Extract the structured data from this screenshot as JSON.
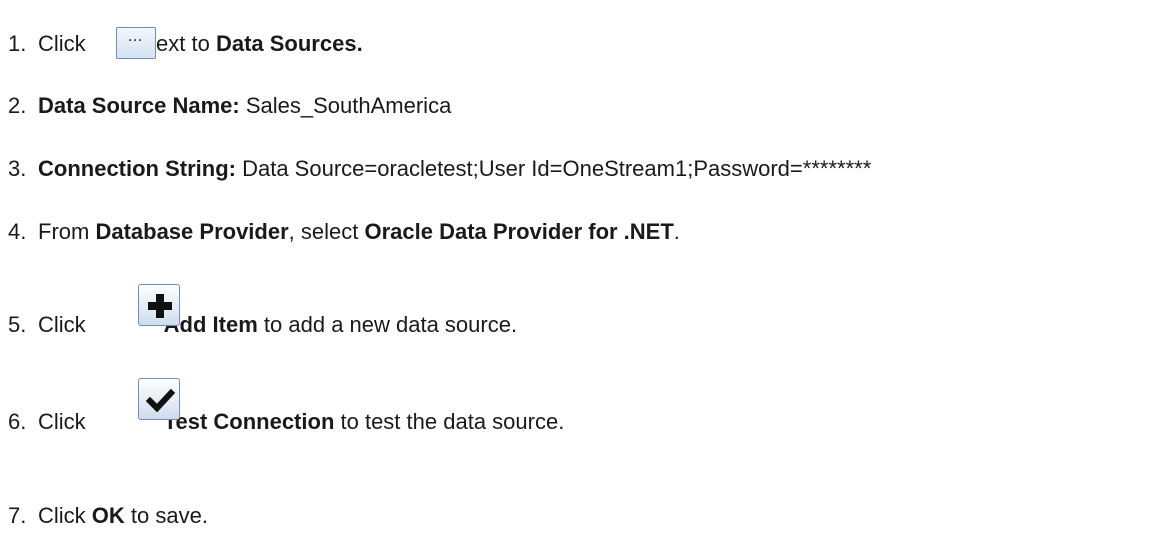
{
  "steps": [
    {
      "num": "1.",
      "pre": "Click",
      "post": " next to ",
      "bold": "Data Sources."
    },
    {
      "num": "2.",
      "bold": "Data Source Name:",
      "text": " Sales_SouthAmerica"
    },
    {
      "num": "3.",
      "bold": "Connection String:",
      "text": " Data Source=oracletest;User Id=OneStream1;Password=********"
    },
    {
      "num": "4.",
      "pre": "From ",
      "bold1": "Database Provider",
      "mid": ", select ",
      "bold2": "Oracle Data Provider for .NET",
      "post": "."
    },
    {
      "num": "5.",
      "pre": "Click",
      "bold": "Add Item",
      "post": " to add a new data source."
    },
    {
      "num": "6.",
      "pre": "Click",
      "bold": "Test Connection",
      "post": " to test the data source."
    },
    {
      "num": "7.",
      "pre": "Click ",
      "bold": "OK",
      "post": " to save."
    }
  ],
  "icons": {
    "ellipsis_glyph": "···",
    "add": "plus-icon",
    "test": "checkmark-icon"
  }
}
